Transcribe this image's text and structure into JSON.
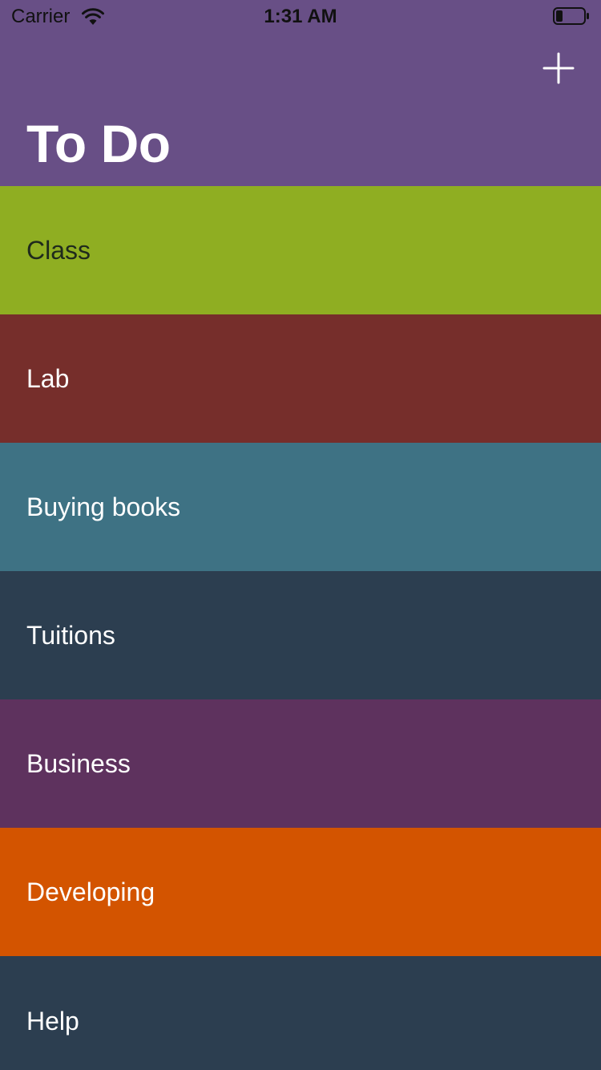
{
  "status_bar": {
    "carrier": "Carrier",
    "time": "1:31 AM",
    "wifi_icon": "wifi-icon",
    "battery_icon": "battery-icon"
  },
  "header": {
    "title": "To Do",
    "background": "#684f86",
    "add_icon": "plus-icon"
  },
  "items": [
    {
      "label": "Class",
      "color": "#8fae22",
      "text_color": "#1f2a1c"
    },
    {
      "label": "Lab",
      "color": "#762e2b",
      "text_color": "#ffffff"
    },
    {
      "label": "Buying books",
      "color": "#3e7284",
      "text_color": "#ffffff"
    },
    {
      "label": "Tuitions",
      "color": "#2c3e50",
      "text_color": "#ffffff"
    },
    {
      "label": "Business",
      "color": "#5e325e",
      "text_color": "#ffffff"
    },
    {
      "label": "Developing",
      "color": "#d35400",
      "text_color": "#ffffff"
    },
    {
      "label": "Help",
      "color": "#2c3e50",
      "text_color": "#ffffff"
    }
  ]
}
